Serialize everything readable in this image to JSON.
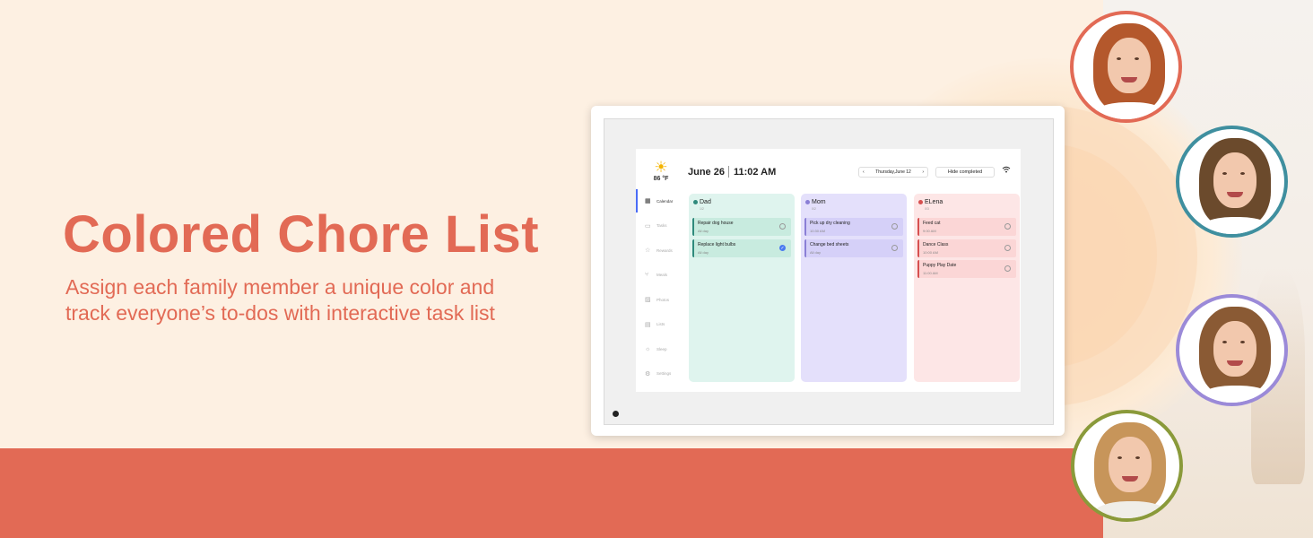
{
  "hero": {
    "title": "Colored Chore List",
    "subtitle_line1": "Assign each family member a unique color and",
    "subtitle_line2": "track everyone’s to-dos with interactive task list"
  },
  "device": {
    "weather": {
      "icon": "sun-icon",
      "temp": "86 °F"
    },
    "date": "June 26",
    "time": "11:02 AM",
    "nav": {
      "prev": "‹",
      "label": "Thursday,June 12",
      "next": "›"
    },
    "hide_completed_label": "Hide completed",
    "sidebar": [
      {
        "label": "Calendar",
        "icon": "calendar-icon",
        "glyph": "▦",
        "active": true
      },
      {
        "label": "Tasks",
        "icon": "tasks-icon",
        "glyph": "▭"
      },
      {
        "label": "Rewards",
        "icon": "star-icon",
        "glyph": "☆"
      },
      {
        "label": "Meals",
        "icon": "meals-icon",
        "glyph": "⑂"
      },
      {
        "label": "Photos",
        "icon": "photos-icon",
        "glyph": "▨"
      },
      {
        "label": "Lists",
        "icon": "lists-icon",
        "glyph": "▤"
      },
      {
        "label": "Sleep",
        "icon": "sleep-icon",
        "glyph": "☼"
      },
      {
        "label": "Settings",
        "icon": "settings-icon",
        "glyph": "⚙"
      }
    ],
    "columns": [
      {
        "name": "Dad",
        "sub": "1/2",
        "color": "#2f8a7c",
        "bg": "#dff4ee",
        "task_bg": "#c8ebdf",
        "tasks": [
          {
            "title": "Repair dog house",
            "when": "All day",
            "done": false
          },
          {
            "title": "Replace light bulbs",
            "when": "All day",
            "done": true
          }
        ]
      },
      {
        "name": "Mom",
        "sub": "0/2",
        "color": "#8a7fd6",
        "bg": "#e4e0fb",
        "task_bg": "#d5d0f8",
        "tasks": [
          {
            "title": "Pick up dry cleaning",
            "when": "10:30 AM",
            "done": false
          },
          {
            "title": "Change bed sheets",
            "when": "All day",
            "done": false
          }
        ]
      },
      {
        "name": "ELena",
        "sub": "0/3",
        "color": "#d64f4f",
        "bg": "#fde6e6",
        "task_bg": "#fbd6d6",
        "tasks": [
          {
            "title": "Feed cat",
            "when": "9:00 AM",
            "done": false
          },
          {
            "title": "Dance Class",
            "when": "10:00 AM",
            "done": false
          },
          {
            "title": "Puppy Play Date",
            "when": "11:00 AM",
            "done": false
          }
        ]
      }
    ],
    "fab_label": "+"
  },
  "avatars": [
    {
      "name": "girl-avatar",
      "ring": "#e26a55",
      "hair": "#b4582c",
      "shirt": "#ffffff"
    },
    {
      "name": "boy-avatar",
      "ring": "#3f8f9f",
      "hair": "#6b4a2c",
      "shirt": "#ffffff"
    },
    {
      "name": "woman-avatar",
      "ring": "#9b8ad8",
      "hair": "#8a5a34",
      "shirt": "#ffffff"
    },
    {
      "name": "child-avatar",
      "ring": "#8a9a3a",
      "hair": "#c7955a",
      "shirt": "#f0eee8"
    }
  ]
}
